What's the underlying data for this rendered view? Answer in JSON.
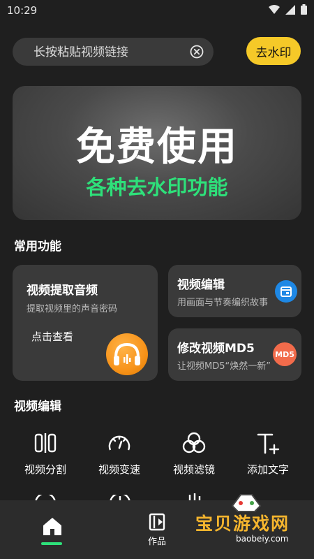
{
  "status": {
    "time": "10:29"
  },
  "search": {
    "placeholder": "长按粘贴视频链接",
    "button_label": "去水印"
  },
  "banner": {
    "title": "免费使用",
    "subtitle": "各种去水印功能"
  },
  "common": {
    "title": "常用功能",
    "extract": {
      "title": "视频提取音频",
      "desc": "提取视频里的声音密码",
      "link": "点击查看"
    },
    "edit": {
      "title": "视频编辑",
      "desc": "用画面与节奏编织故事"
    },
    "md5": {
      "title": "修改视频MD5",
      "desc": "让视频MD5“焕然一新”",
      "badge": "MD5"
    }
  },
  "video_edit": {
    "title": "视频编辑",
    "tools": [
      {
        "label": "视频分割",
        "icon": "split-icon"
      },
      {
        "label": "视频变速",
        "icon": "speed-icon"
      },
      {
        "label": "视频滤镜",
        "icon": "filter-icon"
      },
      {
        "label": "添加文字",
        "icon": "add-text-icon"
      }
    ]
  },
  "nav": {
    "works_label": "作品"
  },
  "watermark": {
    "text": "宝贝游戏网",
    "url": "baobeiy.com"
  },
  "colors": {
    "accent_yellow": "#f5c928",
    "accent_green": "#2ee07a",
    "background": "#1f1f1f",
    "card": "#3a3a3a"
  }
}
